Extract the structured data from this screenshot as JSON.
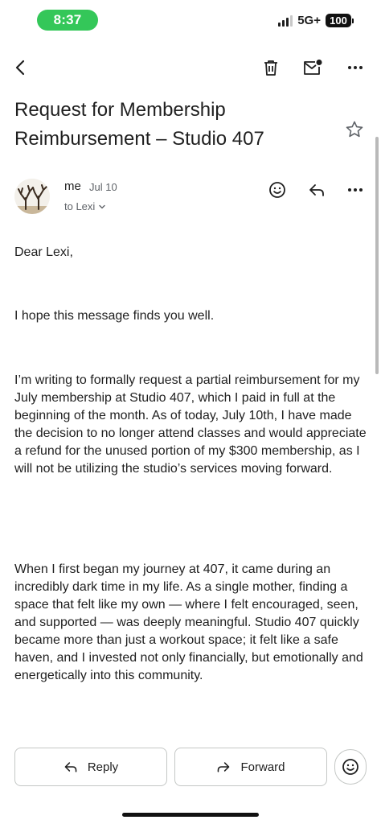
{
  "status_bar": {
    "time": "8:37",
    "network": "5G+",
    "battery": "100",
    "signal_bars": 4,
    "signal_bars_filled": 3,
    "time_pill_color": "#34c759"
  },
  "toolbar": {
    "icons": [
      "back-arrow-icon",
      "delete-icon",
      "mark-unread-icon",
      "more-icon"
    ]
  },
  "email": {
    "subject": "Request for Membership Reimbursement – Studio 407",
    "sender": "me",
    "date": "Jul 10",
    "recipient": "to Lexi",
    "greeting": "Dear Lexi,",
    "paragraphs": [
      "I hope this message finds you well.",
      "I’m writing to formally request a partial reimbursement for my July membership at Studio 407, which I paid in full at the beginning of the month. As of today, July 10th, I have made the decision to no longer attend classes and would appreciate a refund for the unused portion of my $300 membership, as I will not be utilizing the studio’s services moving forward.",
      "When I first began my journey at 407, it came during an incredibly dark time in my life. As a single mother, finding a space that felt like my own — where I felt encouraged, seen, and supported — was deeply meaningful. Studio 407 quickly became more than just a workout space; it felt like a safe haven, and I invested not only financially, but emotionally and energetically into this community."
    ]
  },
  "actions": {
    "reply_label": "Reply",
    "forward_label": "Forward"
  }
}
